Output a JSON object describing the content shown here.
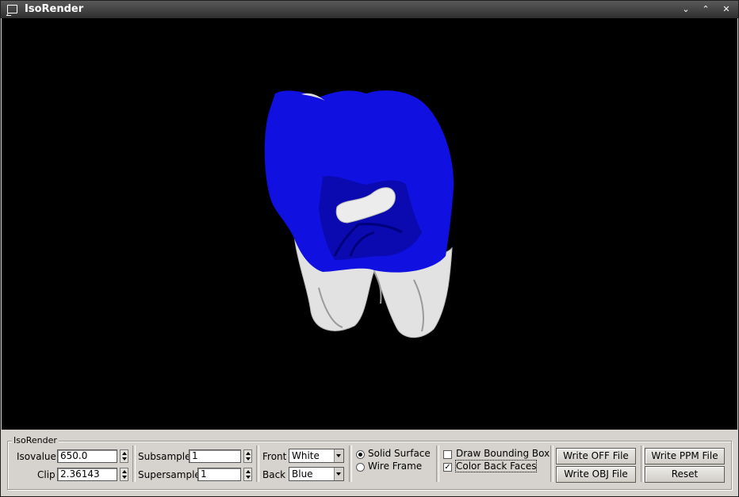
{
  "window": {
    "title": "IsoRender",
    "buttons": {
      "minimize": "⌄",
      "maximize": "⌃",
      "close": "✕"
    }
  },
  "render": {
    "front_color": "#e8e8e8",
    "back_color": "#1010e0",
    "background": "#000000"
  },
  "panel": {
    "group_title": "IsoRender",
    "isovalue_label": "Isovalue",
    "isovalue_value": "650.0",
    "clip_label": "Clip",
    "clip_value": "2.36143",
    "subsample_label": "Subsample",
    "subsample_value": "1",
    "supersample_label": "Supersample",
    "supersample_value": "1",
    "front_label": "Front",
    "front_value": "White",
    "back_label": "Back",
    "back_value": "Blue",
    "solid_surface_label": "Solid Surface",
    "wire_frame_label": "Wire Frame",
    "draw_bbox_label": "Draw Bounding Box",
    "color_back_faces_label": "Color Back Faces",
    "write_off_label": "Write OFF File",
    "write_obj_label": "Write OBJ File",
    "write_ppm_label": "Write PPM File",
    "reset_label": "Reset"
  }
}
